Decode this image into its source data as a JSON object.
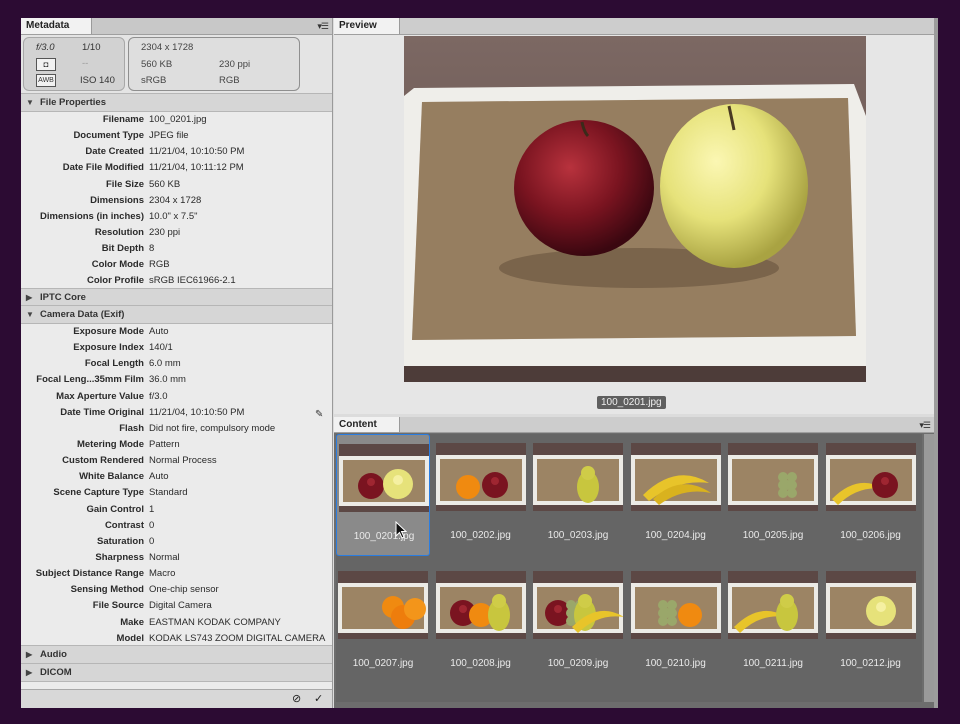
{
  "metadata_panel": {
    "tab_label": "Metadata",
    "summary": {
      "aperture": "f/3.0",
      "shutter": "1/10",
      "exposure_comp": "--",
      "white_balance_badge": "AWB",
      "iso": "ISO 140",
      "dimensions": "2304 x 1728",
      "file_size": "560 KB",
      "resolution": "230 ppi",
      "color_profile": "sRGB",
      "color_mode": "RGB"
    },
    "sections": {
      "file_properties": {
        "title": "File Properties",
        "rows": [
          {
            "label": "Filename",
            "value": "100_0201.jpg"
          },
          {
            "label": "Document Type",
            "value": "JPEG file"
          },
          {
            "label": "Date Created",
            "value": "11/21/04, 10:10:50 PM"
          },
          {
            "label": "Date File Modified",
            "value": "11/21/04, 10:11:12 PM"
          },
          {
            "label": "File Size",
            "value": "560 KB"
          },
          {
            "label": "Dimensions",
            "value": "2304 x 1728"
          },
          {
            "label": "Dimensions (in inches)",
            "value": "10.0\" x 7.5\""
          },
          {
            "label": "Resolution",
            "value": "230 ppi"
          },
          {
            "label": "Bit Depth",
            "value": "8"
          },
          {
            "label": "Color Mode",
            "value": "RGB"
          },
          {
            "label": "Color Profile",
            "value": "sRGB IEC61966-2.1"
          }
        ]
      },
      "iptc_core": {
        "title": "IPTC Core"
      },
      "camera_data": {
        "title": "Camera Data (Exif)",
        "rows": [
          {
            "label": "Exposure Mode",
            "value": "Auto"
          },
          {
            "label": "Exposure Index",
            "value": "140/1"
          },
          {
            "label": "Focal Length",
            "value": "6.0 mm"
          },
          {
            "label": "Focal Leng...35mm Film",
            "value": "36.0 mm"
          },
          {
            "label": "Max Aperture Value",
            "value": "f/3.0"
          },
          {
            "label": "Date Time Original",
            "value": "11/21/04, 10:10:50 PM"
          },
          {
            "label": "Flash",
            "value": "Did not fire, compulsory mode"
          },
          {
            "label": "Metering Mode",
            "value": "Pattern"
          },
          {
            "label": "Custom Rendered",
            "value": "Normal Process"
          },
          {
            "label": "White Balance",
            "value": "Auto"
          },
          {
            "label": "Scene Capture Type",
            "value": "Standard"
          },
          {
            "label": "Gain Control",
            "value": "1"
          },
          {
            "label": "Contrast",
            "value": "0"
          },
          {
            "label": "Saturation",
            "value": "0"
          },
          {
            "label": "Sharpness",
            "value": "Normal"
          },
          {
            "label": "Subject Distance Range",
            "value": "Macro"
          },
          {
            "label": "Sensing Method",
            "value": "One-chip sensor"
          },
          {
            "label": "File Source",
            "value": "Digital Camera"
          },
          {
            "label": "Make",
            "value": "EASTMAN KODAK COMPANY"
          },
          {
            "label": "Model",
            "value": "KODAK LS743 ZOOM DIGITAL CAMERA"
          }
        ]
      },
      "audio": {
        "title": "Audio"
      },
      "dicom": {
        "title": "DICOM"
      }
    }
  },
  "preview_panel": {
    "tab_label": "Preview",
    "caption": "100_0201.jpg"
  },
  "content_panel": {
    "tab_label": "Content",
    "selected_index": 0,
    "thumbnails": [
      {
        "filename": "100_0201.jpg",
        "fruits": [
          "apple-red",
          "apple-yellow"
        ]
      },
      {
        "filename": "100_0202.jpg",
        "fruits": [
          "orange",
          "apple-red"
        ]
      },
      {
        "filename": "100_0203.jpg",
        "fruits": [
          "pear"
        ]
      },
      {
        "filename": "100_0204.jpg",
        "fruits": [
          "bananas"
        ]
      },
      {
        "filename": "100_0205.jpg",
        "fruits": [
          "grapes"
        ]
      },
      {
        "filename": "100_0206.jpg",
        "fruits": [
          "banana",
          "apple-red"
        ]
      },
      {
        "filename": "100_0207.jpg",
        "fruits": [
          "oranges"
        ]
      },
      {
        "filename": "100_0208.jpg",
        "fruits": [
          "apple-red",
          "orange",
          "pear"
        ]
      },
      {
        "filename": "100_0209.jpg",
        "fruits": [
          "apple-red",
          "grapes",
          "pear",
          "banana"
        ]
      },
      {
        "filename": "100_0210.jpg",
        "fruits": [
          "grapes",
          "orange"
        ]
      },
      {
        "filename": "100_0211.jpg",
        "fruits": [
          "banana",
          "pear"
        ]
      },
      {
        "filename": "100_0212.jpg",
        "fruits": [
          "apple-yellow"
        ]
      }
    ]
  },
  "colors": {
    "app_background": "#2c0b33",
    "selection_accent": "#2a7de1",
    "thumb_grid": "#656565",
    "apple_red": "#7a1420",
    "apple_yellow": "#e6e27a"
  }
}
